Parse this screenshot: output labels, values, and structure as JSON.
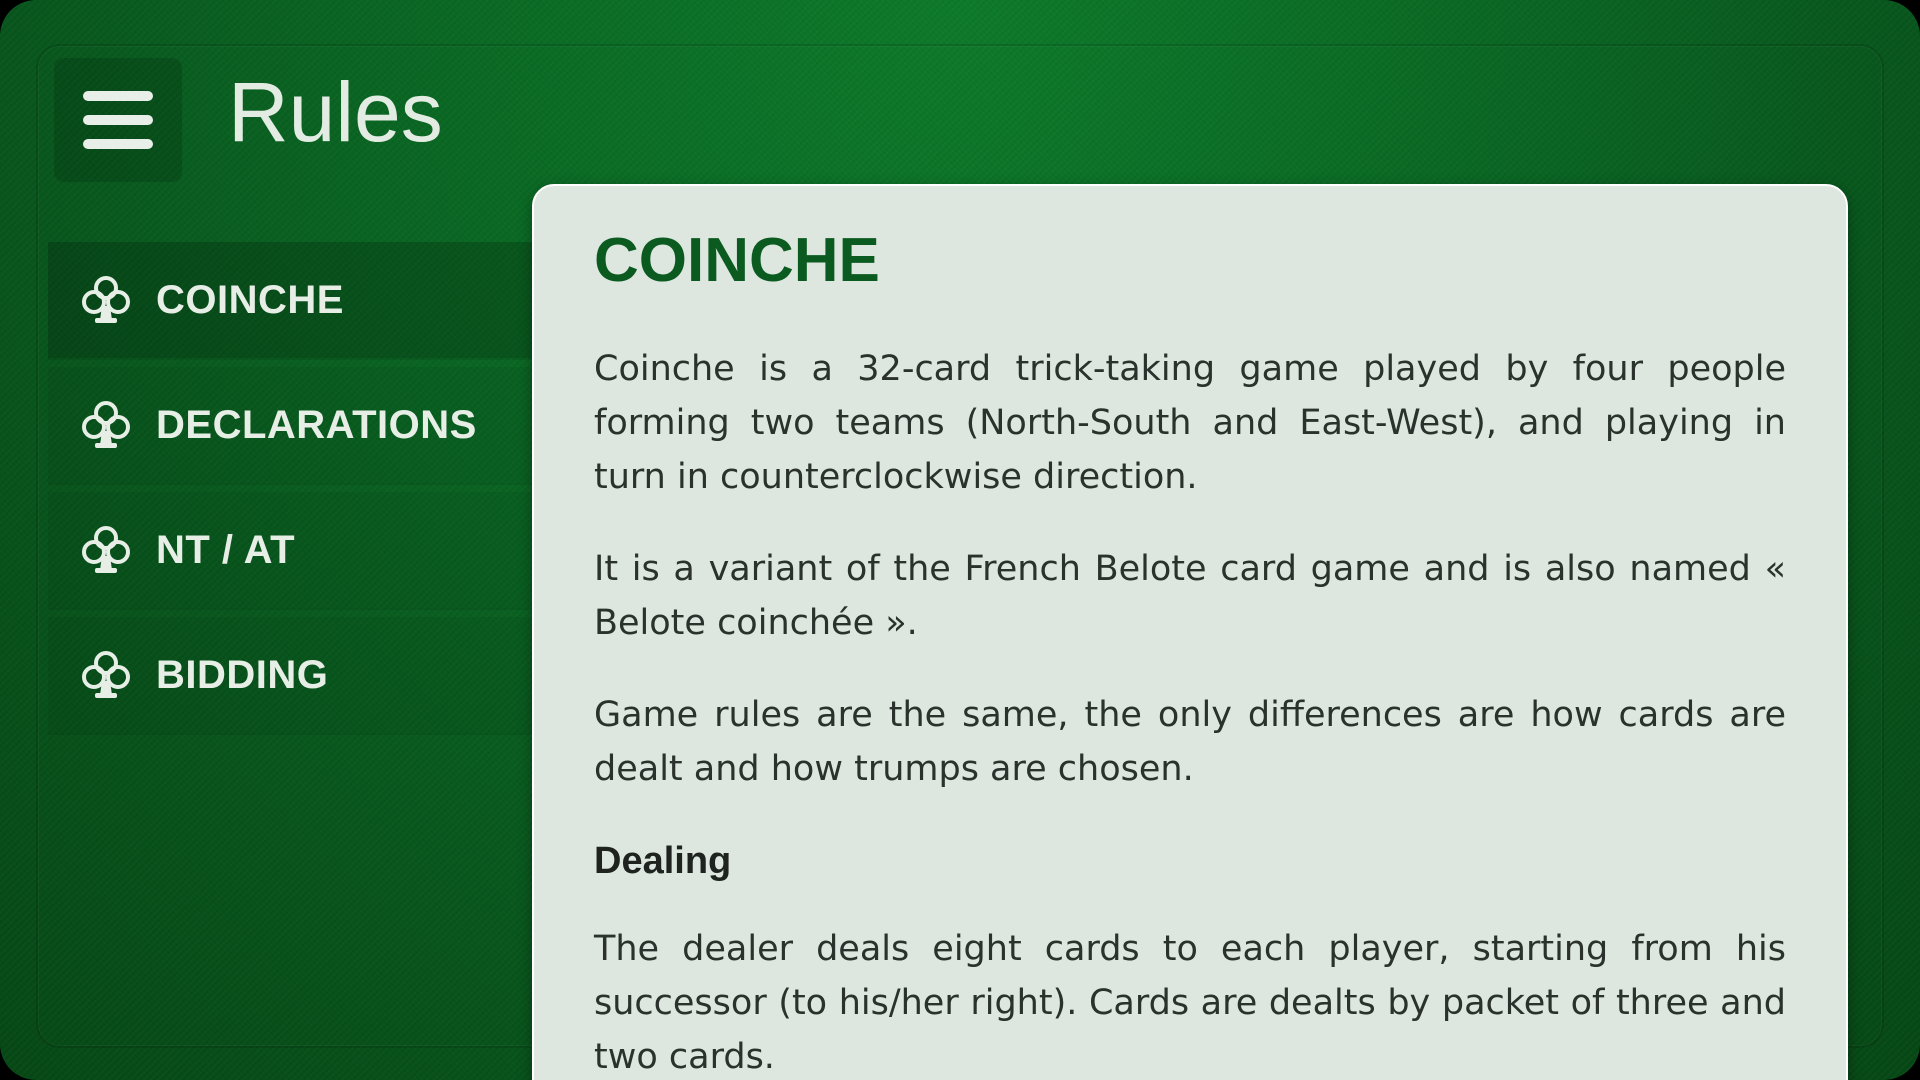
{
  "header": {
    "title": "Rules",
    "menu_icon": "hamburger-menu-icon"
  },
  "sidebar": {
    "items": [
      {
        "label": "COINCHE",
        "icon": "club-suit-icon",
        "active": true
      },
      {
        "label": "DECLARATIONS",
        "icon": "club-suit-icon",
        "active": false
      },
      {
        "label": "NT / AT",
        "icon": "club-suit-icon",
        "active": false
      },
      {
        "label": "BIDDING",
        "icon": "club-suit-icon",
        "active": false
      }
    ]
  },
  "content": {
    "heading": "COINCHE",
    "paragraphs": [
      "Coinche is a 32-card trick-taking game played by four people forming two teams (North-South and East-West), and playing in turn in counterclockwise direction.",
      "It is a variant of the French Belote card game and is also named « Belote coinchée ».",
      "Game rules are the same, the only differences are how cards are dealt and how trumps are chosen."
    ],
    "subheading": "Dealing",
    "dealing_paragraph": "The dealer deals eight cards to each player, starting from his successor (to his/her right). Cards are dealts by packet of three and two cards."
  },
  "colors": {
    "felt_green": "#0a6a24",
    "card_background": "#dde7df",
    "heading_green": "#0b5b20",
    "text_light": "#e6eee6",
    "text_dark": "#2b312c"
  }
}
